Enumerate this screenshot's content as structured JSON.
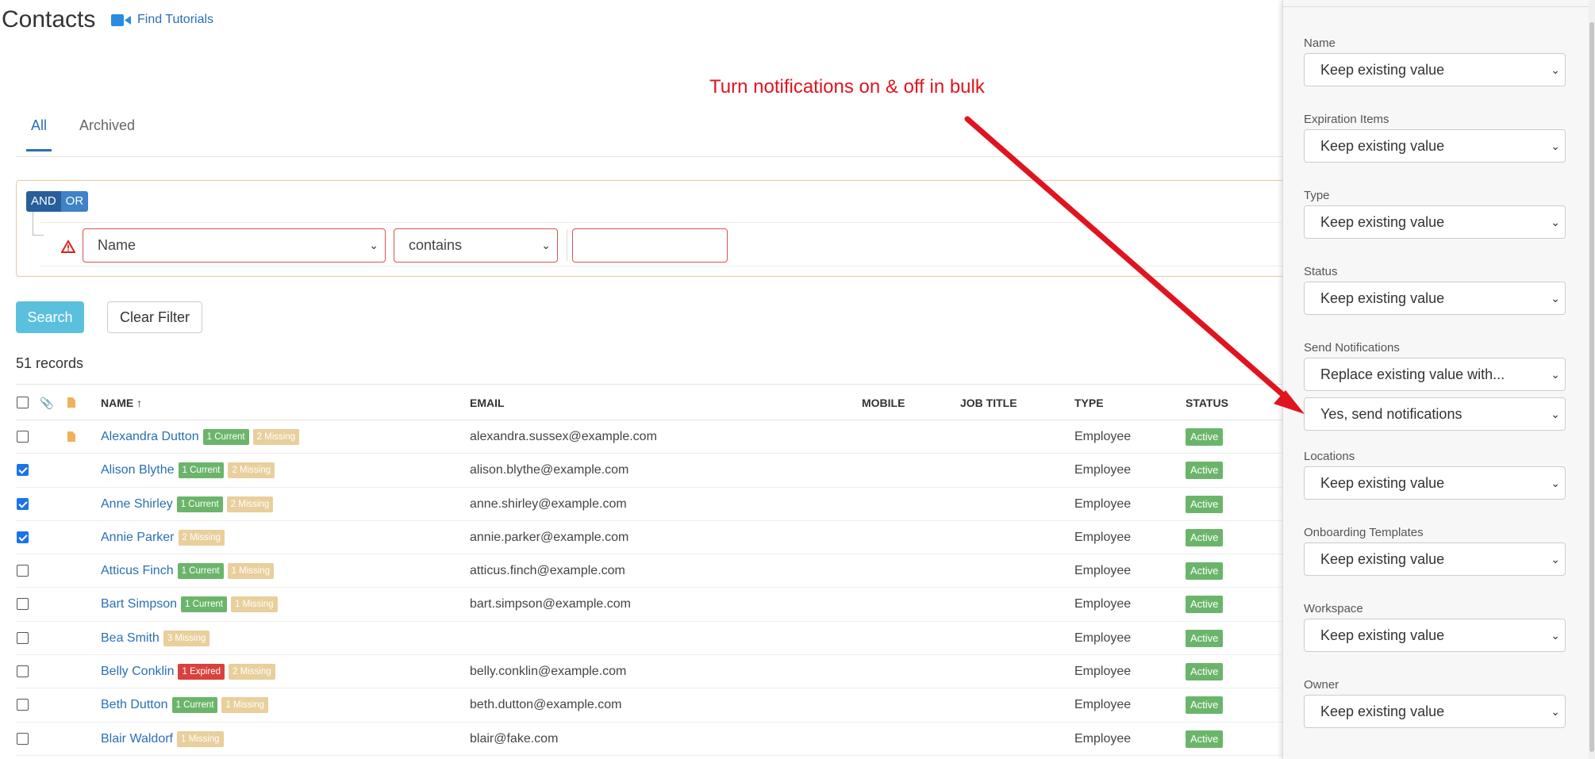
{
  "header": {
    "title": "Contacts",
    "tutorials_label": "Find Tutorials",
    "tutorials_icon": "video-camera-icon"
  },
  "annotation": {
    "text": "Turn notifications on & off in bulk",
    "color": "#e0141e"
  },
  "tabs": [
    {
      "label": "All",
      "active": true
    },
    {
      "label": "Archived",
      "active": false
    }
  ],
  "filter": {
    "and_label": "AND",
    "or_label": "OR",
    "field": "Name",
    "operator": "contains",
    "value": ""
  },
  "buttons": {
    "search": "Search",
    "clear_filter": "Clear Filter"
  },
  "records_count": "51 records",
  "table": {
    "columns": {
      "name": "NAME ↑",
      "email": "EMAIL",
      "mobile": "MOBILE",
      "job_title": "JOB TITLE",
      "type": "TYPE",
      "status": "STATUS"
    },
    "rows": [
      {
        "name": "Alexandra Dutton",
        "checked": false,
        "file": true,
        "badges": [
          {
            "text": "1 Current",
            "kind": "current"
          },
          {
            "text": "2 Missing",
            "kind": "missing"
          }
        ],
        "email": "alexandra.sussex@example.com",
        "type": "Employee",
        "status": "Active"
      },
      {
        "name": "Alison Blythe",
        "checked": true,
        "file": false,
        "badges": [
          {
            "text": "1 Current",
            "kind": "current"
          },
          {
            "text": "2 Missing",
            "kind": "missing"
          }
        ],
        "email": "alison.blythe@example.com",
        "type": "Employee",
        "status": "Active"
      },
      {
        "name": "Anne Shirley",
        "checked": true,
        "file": false,
        "badges": [
          {
            "text": "1 Current",
            "kind": "current"
          },
          {
            "text": "2 Missing",
            "kind": "missing"
          }
        ],
        "email": "anne.shirley@example.com",
        "type": "Employee",
        "status": "Active"
      },
      {
        "name": "Annie Parker",
        "checked": true,
        "file": false,
        "badges": [
          {
            "text": "2 Missing",
            "kind": "missing"
          }
        ],
        "email": "annie.parker@example.com",
        "type": "Employee",
        "status": "Active"
      },
      {
        "name": "Atticus Finch",
        "checked": false,
        "file": false,
        "badges": [
          {
            "text": "1 Current",
            "kind": "current"
          },
          {
            "text": "1 Missing",
            "kind": "missing"
          }
        ],
        "email": "atticus.finch@example.com",
        "type": "Employee",
        "status": "Active"
      },
      {
        "name": "Bart Simpson",
        "checked": false,
        "file": false,
        "badges": [
          {
            "text": "1 Current",
            "kind": "current"
          },
          {
            "text": "1 Missing",
            "kind": "missing"
          }
        ],
        "email": "bart.simpson@example.com",
        "type": "Employee",
        "status": "Active"
      },
      {
        "name": "Bea Smith",
        "checked": false,
        "file": false,
        "badges": [
          {
            "text": "3 Missing",
            "kind": "missing"
          }
        ],
        "email": "",
        "type": "Employee",
        "status": "Active"
      },
      {
        "name": "Belly Conklin",
        "checked": false,
        "file": false,
        "badges": [
          {
            "text": "1 Expired",
            "kind": "expired"
          },
          {
            "text": "2 Missing",
            "kind": "missing"
          }
        ],
        "email": "belly.conklin@example.com",
        "type": "Employee",
        "status": "Active"
      },
      {
        "name": "Beth Dutton",
        "checked": false,
        "file": false,
        "badges": [
          {
            "text": "1 Current",
            "kind": "current"
          },
          {
            "text": "1 Missing",
            "kind": "missing"
          }
        ],
        "email": "beth.dutton@example.com",
        "type": "Employee",
        "status": "Active"
      },
      {
        "name": "Blair Waldorf",
        "checked": false,
        "file": false,
        "badges": [
          {
            "text": "1 Missing",
            "kind": "missing"
          }
        ],
        "email": "blair@fake.com",
        "type": "Employee",
        "status": "Active"
      }
    ]
  },
  "panel": {
    "fields": [
      {
        "label": "Name",
        "value": "Keep existing value"
      },
      {
        "label": "Expiration Items",
        "value": "Keep existing value"
      },
      {
        "label": "Type",
        "value": "Keep existing value"
      },
      {
        "label": "Status",
        "value": "Keep existing value"
      },
      {
        "label": "Send Notifications",
        "value": "Replace existing value with...",
        "second_value": "Yes, send notifications"
      },
      {
        "label": "Locations",
        "value": "Keep existing value"
      },
      {
        "label": "Onboarding Templates",
        "value": "Keep existing value"
      },
      {
        "label": "Workspace",
        "value": "Keep existing value"
      },
      {
        "label": "Owner",
        "value": "Keep existing value"
      }
    ]
  },
  "colors": {
    "link": "#2a6fb5",
    "badge_current": "#6bb56b",
    "badge_missing": "#e8cf9c",
    "badge_expired": "#d9413d",
    "status_active": "#6bb56b",
    "search_button": "#5bc0de"
  }
}
